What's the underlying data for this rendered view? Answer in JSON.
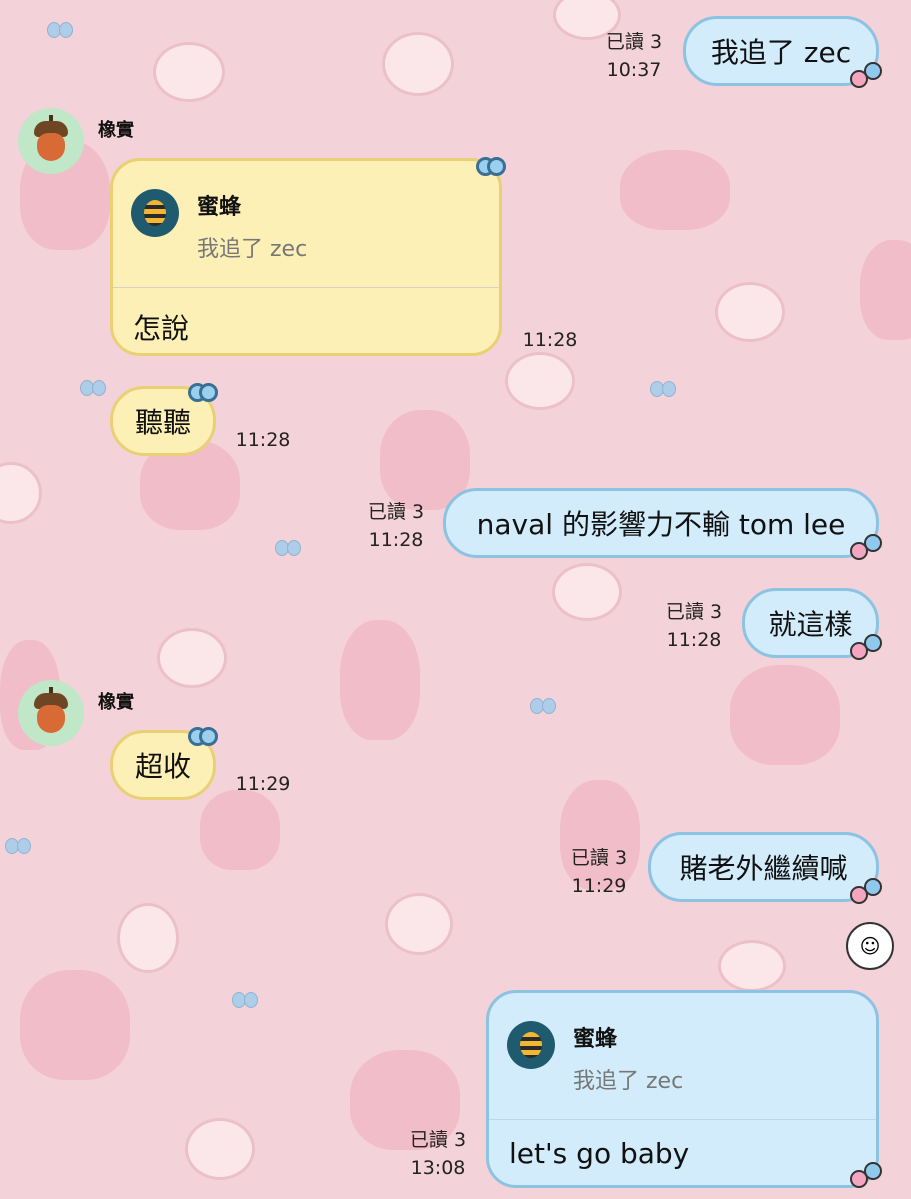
{
  "colors": {
    "background": "#f3d3d9",
    "outgoing_bubble": "#d2ecfb",
    "incoming_bubble": "#fdf0b6",
    "avatar_bg": "#bfe7c8"
  },
  "contact": {
    "name": "橡實",
    "avatar_icon": "acorn-icon"
  },
  "messages": [
    {
      "id": "m1",
      "side": "out",
      "text": "我追了 zec",
      "read": "已讀 3",
      "time": "10:37"
    },
    {
      "id": "m2",
      "side": "in",
      "sender": "橡實",
      "quote": {
        "name": "蜜蜂",
        "text": "我追了 zec",
        "avatar_icon": "bee-icon"
      },
      "text": "怎說",
      "time": "11:28"
    },
    {
      "id": "m3",
      "side": "in",
      "text": "聽聽",
      "time": "11:28"
    },
    {
      "id": "m4",
      "side": "out",
      "text": "naval 的影響力不輸 tom lee",
      "read": "已讀 3",
      "time": "11:28"
    },
    {
      "id": "m5",
      "side": "out",
      "text": "就這樣",
      "read": "已讀 3",
      "time": "11:28"
    },
    {
      "id": "m6",
      "side": "in",
      "sender": "橡實",
      "text": "超收",
      "time": "11:29"
    },
    {
      "id": "m7",
      "side": "out",
      "text": "賭老外繼續喊",
      "read": "已讀 3",
      "time": "11:29"
    },
    {
      "id": "m8",
      "side": "out",
      "quote": {
        "name": "蜜蜂",
        "text": "我追了 zec",
        "avatar_icon": "bee-icon"
      },
      "text": "let's go baby",
      "read": "已讀 3",
      "time": "13:08"
    }
  ],
  "sticker": {
    "icon": "smiling-face-sticker-icon",
    "glyph": "☺"
  }
}
